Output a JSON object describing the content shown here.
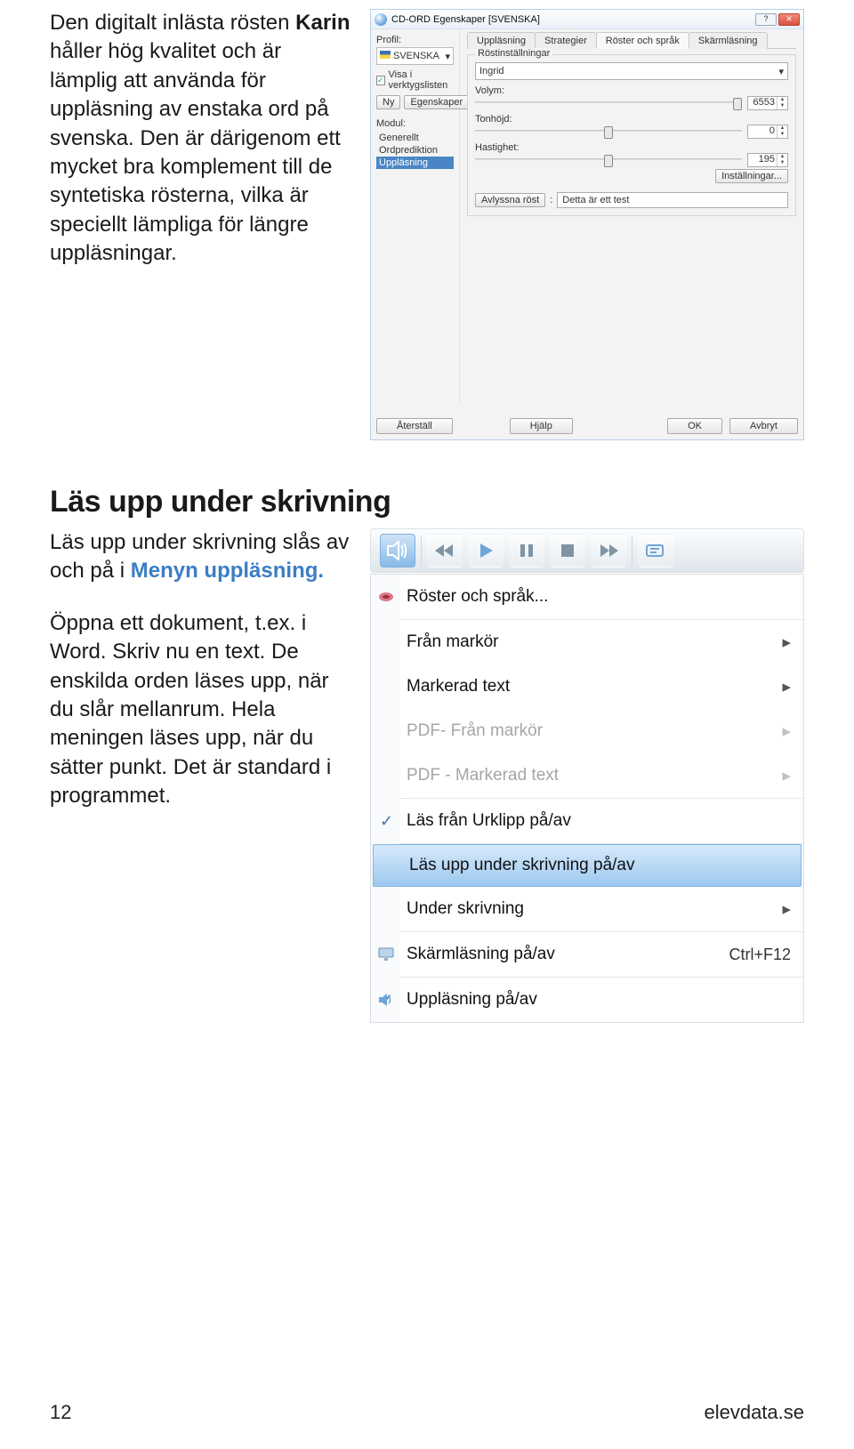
{
  "text": {
    "p1a": "Den digitalt inlästa rösten ",
    "karin": "Karin",
    "p1b": " håller hög kvalitet och är lämplig att använda för uppläsning av enstaka ord på svenska. Den är därigenom ett mycket bra komplement till de syntetiska rösterna, vilka är speciellt lämpliga för längre uppläsningar.",
    "h2": "Läs upp under skrivning",
    "p2a": "Läs upp under skrivning slås av och på i ",
    "menyn": "Menyn uppläsning.",
    "p3": "Öppna ett dokument, t.ex. i Word. Skriv nu en text. De enskilda orden läses upp, när du slår mellanrum. Hela meningen läses upp, när du sätter punkt. Det är standard i programmet."
  },
  "dialog": {
    "title": "CD-ORD Egenskaper [SVENSKA]",
    "profile_label": "Profil:",
    "profile_value": "SVENSKA",
    "show_in_toolbar": "Visa i verktygslisten",
    "new_btn": "Ny",
    "props_btn": "Egenskaper",
    "module_label": "Modul:",
    "modules": [
      "Generellt",
      "Ordprediktion",
      "Uppläsning"
    ],
    "tabs": [
      "Uppläsning",
      "Strategier",
      "Röster och språk",
      "Skärmläsning"
    ],
    "voice_group": "Röstinställningar",
    "voice_value": "Ingrid",
    "volume": "Volym:",
    "pitch": "Tonhöjd:",
    "speed": "Hastighet:",
    "volume_val": "6553",
    "pitch_val": "0",
    "speed_val": "195",
    "settings_btn": "Inställningar...",
    "listen_btn": "Avlyssna röst",
    "test_text": "Detta är ett test",
    "reset": "Återställ",
    "help": "Hjälp",
    "ok": "OK",
    "cancel": "Avbryt"
  },
  "menu": {
    "voices": "Röster och språk...",
    "from_cursor": "Från markör",
    "marked_text": "Markerad text",
    "pdf_from_cursor": "PDF- Från markör",
    "pdf_marked": "PDF - Markerad text",
    "read_clipboard": "Läs från Urklipp på/av",
    "read_while_typing": "Läs upp under skrivning på/av",
    "while_typing": "Under skrivning",
    "screen_read": "Skärmläsning på/av",
    "screen_shortcut": "Ctrl+F12",
    "reading_onoff": "Uppläsning på/av"
  },
  "footer": {
    "page": "12",
    "site": "elevdata.se"
  }
}
